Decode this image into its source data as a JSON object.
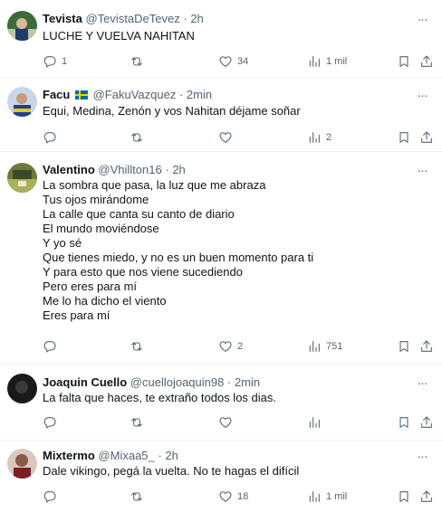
{
  "tweets": [
    {
      "name": "Tevista",
      "handle": "@TevistaDeTevez",
      "sep": "·",
      "time": "2h",
      "more": "···",
      "lines": [
        "LUCHE Y VUELVA NAHITAN"
      ],
      "replies": "1",
      "retweets": "",
      "likes": "34",
      "views": "1 mil",
      "avatar_color": "#3d6b3a"
    },
    {
      "name": "Facu",
      "handle": "@FakuVazquez",
      "sep": "·",
      "time": "2min",
      "more": "···",
      "lines": [
        "Equi, Medina, Zenón y vos Nahitan déjame soñar"
      ],
      "replies": "",
      "retweets": "",
      "likes": "",
      "views": "2",
      "avatar_color": "#1f3f8f"
    },
    {
      "name": "Valentino",
      "handle": "@Vhillton16",
      "sep": "·",
      "time": "2h",
      "more": "···",
      "lines": [
        "La sombra que pasa, la luz que me abraza",
        "Tus ojos mirándome",
        "La calle que canta su canto de diario",
        "El mundo moviéndose",
        "Y yo sé",
        "Que tienes miedo, y no es un buen momento para ti",
        "Y para esto que nos viene sucediendo",
        "Pero eres para mí",
        "Me lo ha dicho el viento",
        "Eres para mí"
      ],
      "replies": "",
      "retweets": "",
      "likes": "2",
      "views": "751",
      "avatar_color": "#6b7a3a"
    },
    {
      "name": "Joaquin Cuello",
      "handle": "@cuellojoaquin98",
      "sep": "·",
      "time": "2min",
      "more": "···",
      "lines": [
        "La falta que haces, te extraño todos los dias."
      ],
      "replies": "",
      "retweets": "",
      "likes": "",
      "views": "",
      "avatar_color": "#1a1a1a"
    },
    {
      "name": "Mixtermo",
      "handle": "@Mixaa5_",
      "sep": "·",
      "time": "2h",
      "more": "···",
      "lines": [
        "Dale vikingo, pegá la vuelta. No te hagas el difícil"
      ],
      "replies": "",
      "retweets": "",
      "likes": "18",
      "views": "1 mil",
      "avatar_color": "#8a5a48"
    }
  ],
  "colors": {
    "text": "#0f1419",
    "secondary": "#536471",
    "divider": "#eff3f4"
  }
}
